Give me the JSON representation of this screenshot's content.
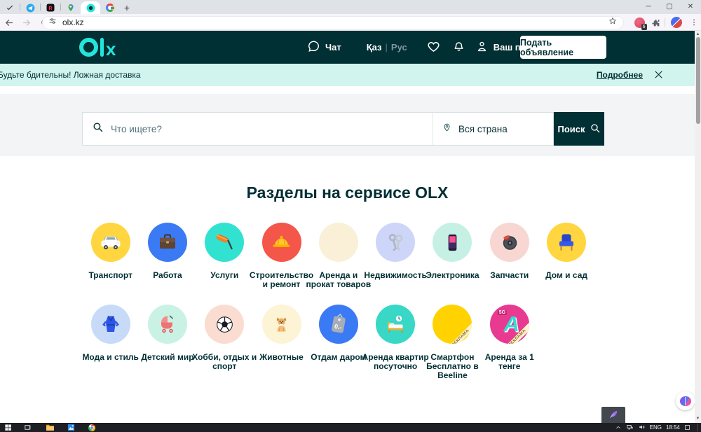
{
  "browser": {
    "tabs": [
      {
        "icon": "checkmark-icon",
        "active": false
      },
      {
        "icon": "telegram-icon",
        "active": false
      },
      {
        "icon": "r-app-icon",
        "active": false
      },
      {
        "icon": "google-maps-icon",
        "active": false
      },
      {
        "icon": "olx-favicon",
        "active": true
      },
      {
        "icon": "google-icon",
        "active": false
      }
    ],
    "new_tab_label": "+",
    "window_controls": {
      "minimize": "─",
      "maximize": "▢",
      "close": "✕"
    },
    "url": "olx.kz",
    "extension_badge": "6"
  },
  "olx": {
    "header": {
      "logo_text": "olx",
      "logo_x": "x",
      "chat_label": "Чат",
      "lang_primary": "Қаз",
      "lang_separator": "|",
      "lang_secondary": "Рус",
      "profile_label": "Ваш профиль",
      "post_ad_label": "Подать объявление"
    },
    "banner": {
      "text": "Будьте бдительны! Ложная доставка",
      "details_label": "Подробнее"
    },
    "search": {
      "query_placeholder": "Что ищете?",
      "location_value": "Вся страна",
      "submit_label": "Поиск"
    },
    "sections_title": "Разделы на сервисе OLX",
    "categories": {
      "row1": [
        {
          "label": "Транспорт",
          "icon": "car-icon",
          "bg": "#ffd640"
        },
        {
          "label": "Работа",
          "icon": "briefcase-icon",
          "bg": "#3b7af5"
        },
        {
          "label": "Услуги",
          "icon": "paint-roller-icon",
          "bg": "#31e2d1"
        },
        {
          "label": "Строительство и ремонт",
          "icon": "hard-hat-icon",
          "bg": "#f4564a"
        },
        {
          "label": "Аренда и прокат товаров",
          "icon": "calendar-icon",
          "bg": "#faf0d7"
        },
        {
          "label": "Недвижимость",
          "icon": "keys-icon",
          "bg": "#cdd6f9"
        },
        {
          "label": "Электроника",
          "icon": "smartphone-icon",
          "bg": "#c6f0e4"
        },
        {
          "label": "Запчасти",
          "icon": "brake-disc-icon",
          "bg": "#f8d7d2"
        },
        {
          "label": "Дом и сад",
          "icon": "chair-icon",
          "bg": "#ffd640"
        }
      ],
      "row2": [
        {
          "label": "Мода и стиль",
          "icon": "dress-icon",
          "bg": "#c7daf8"
        },
        {
          "label": "Детский мир",
          "icon": "stroller-icon",
          "bg": "#c9f2e5"
        },
        {
          "label": "Хобби, отдых и спорт",
          "icon": "soccer-ball-icon",
          "bg": "#fbdcd0"
        },
        {
          "label": "Животные",
          "icon": "dog-icon",
          "bg": "#fdf3d5"
        },
        {
          "label": "Отдам даром",
          "icon": "free-tag-icon",
          "bg": "#3b7af5",
          "tag_text": "0.-"
        },
        {
          "label": "Аренда квартир посуточно",
          "icon": "bed-clock-icon",
          "bg": "#38d7c6"
        },
        {
          "label": "Смартфон Бесплатно в Beeline",
          "icon": "beeline-icon",
          "bg": "#ffd200",
          "ad": "РЕКЛАМА"
        },
        {
          "label": "Аренда за 1 тенге",
          "icon": "arenda-a-icon",
          "bg": "#e93a92",
          "ad": "РЕКЛАМА",
          "badge": "5G",
          "letter": "A"
        }
      ]
    }
  },
  "taskbar": {
    "language": "ENG",
    "time": "18:54"
  },
  "colors": {
    "accent": "#23e5db",
    "header_bg": "#002f34",
    "banner_bg": "#d2f4ee",
    "band_bg": "#f2f4f5"
  }
}
